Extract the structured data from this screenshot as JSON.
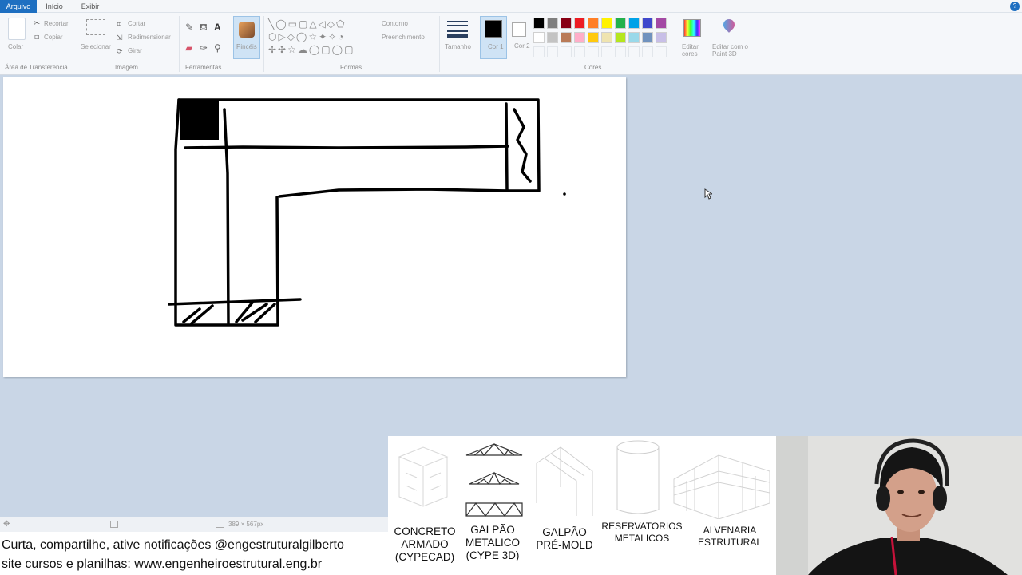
{
  "tabs": {
    "file": "Arquivo",
    "home": "Início",
    "view": "Exibir"
  },
  "clipboard": {
    "paste": "Colar",
    "cut": "Recortar",
    "copy": "Copiar",
    "group": "Área de Transferência"
  },
  "image": {
    "select": "Selecionar",
    "crop": "Cortar",
    "resize": "Redimensionar",
    "rotate": "Girar",
    "group": "Imagem"
  },
  "tools": {
    "group": "Ferramentas"
  },
  "brushes": {
    "label": "Pincéis"
  },
  "shapes": {
    "outline": "Contorno",
    "fill": "Preenchimento",
    "group": "Formas"
  },
  "size": {
    "label": "Tamanho"
  },
  "colors": {
    "color1": "Cor 1",
    "color2": "Cor 2",
    "edit_colors": "Editar cores",
    "edit_paint3d": "Editar com o Paint 3D",
    "group": "Cores",
    "primary": "#000000",
    "secondary": "#ffffff",
    "row1": [
      "#000000",
      "#7f7f7f",
      "#880015",
      "#ed1c24",
      "#ff7f27",
      "#fff200",
      "#22b14c",
      "#00a2e8",
      "#3f48cc",
      "#a349a4"
    ],
    "row2": [
      "#ffffff",
      "#c3c3c3",
      "#b97a57",
      "#ffaec9",
      "#ffc90e",
      "#efe4b0",
      "#b5e61d",
      "#99d9ea",
      "#7092be",
      "#c8bfe7"
    ]
  },
  "status": {
    "dimensions": "389 × 567px"
  },
  "footer": {
    "line1": "Curta, compartilhe, ative notificações @engestruturalgilberto",
    "line2": "site cursos e planilhas: www.engenheiroestrutural.eng.br"
  },
  "products": [
    {
      "line1": "CONCRETO",
      "line2": "ARMADO",
      "line3": "(CYPECAD)"
    },
    {
      "line1": "GALPÃO",
      "line2": "METALICO",
      "line3": "(CYPE 3D)"
    },
    {
      "line1": "GALPÃO",
      "line2": "PRÉ-MOLD",
      "line3": ""
    },
    {
      "line1": "RESERVATORIOS",
      "line2": "METALICOS",
      "line3": ""
    },
    {
      "line1": "ALVENARIA",
      "line2": "ESTRUTURAL",
      "line3": ""
    }
  ]
}
